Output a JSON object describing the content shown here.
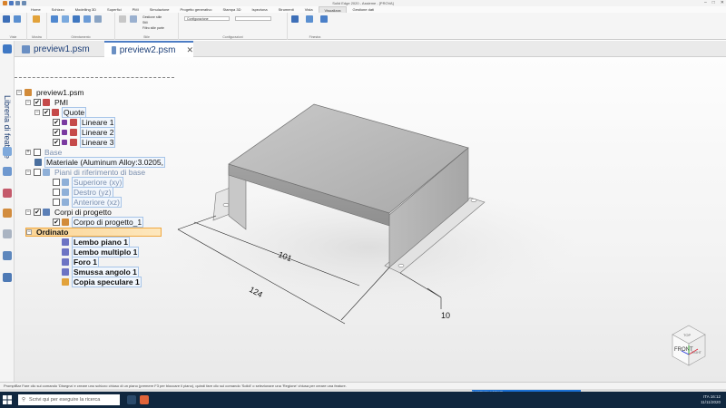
{
  "app": {
    "title": "Solid Edge 2020 - Assieme - [PROVA]"
  },
  "ribbon_tabs": [
    "Home",
    "Schizzo",
    "Modelling 3D",
    "Superfici",
    "PMI",
    "Simulazione",
    "Progetto generativo",
    "Stampa 3D",
    "Ispeziona",
    "Strumenti",
    "Vista",
    "Visualizza",
    "Gestione dati"
  ],
  "active_ribbon_tab": "Visualizza",
  "ribbon": {
    "groups": [
      {
        "label": "Viste",
        "items": [
          "Navigatore",
          "Viste"
        ]
      },
      {
        "label": "Mostra",
        "items": [
          "Mostra/Nascondi",
          "Mostra"
        ]
      },
      {
        "label": "Orientamento",
        "items": [
          "Vista rapida",
          "Zoom",
          "Ingrandisci",
          "Adatta"
        ]
      },
      {
        "label": "Stile",
        "items": [
          "Gestione stile",
          "Stili",
          "Filtro stile parte"
        ]
      },
      {
        "label": "Configurazioni",
        "items": [
          "Configurazione"
        ]
      },
      {
        "label": "Finestra",
        "items": [
          "Nuova finestra",
          "Disponi",
          "Cambia finestra"
        ]
      }
    ]
  },
  "sidebar": {
    "title": "Libreria di feature"
  },
  "doc_tabs": [
    {
      "label": "preview1.psm",
      "active": false
    },
    {
      "label": "preview2.psm",
      "active": true
    }
  ],
  "tree": {
    "root": "preview1.psm",
    "pmi": "PMI",
    "quote": "Quote",
    "dims": [
      "Lineare 1",
      "Lineare 2",
      "Lineare 3"
    ],
    "base": "Base",
    "materiale": "Materiale (Aluminum Alloy:3.0205,",
    "piani": "Piani di riferimento di base",
    "planes": [
      "Superiore (xy)",
      "Destro (yz)",
      "Anteriore (xz)"
    ],
    "corpi": "Corpi di progetto",
    "corpo1": "Corpo di progetto_1",
    "ordinato": "Ordinato",
    "features": [
      "Lembo piano 1",
      "Lembo multiplo 1",
      "Foro 1",
      "Smussa angolo 1",
      "Copia speculare 1"
    ]
  },
  "model": {
    "dims": [
      "101",
      "124",
      "10"
    ],
    "view_cube": {
      "front": "FRONT",
      "top": "TOP",
      "right": "RIGHT"
    }
  },
  "prompt_text": "PromptBar   Fare clic sul comando 'Disegna' e creare uno schizzo chiuso di un piano (premere F3 per bloccare il piano), quindi fare clic sul comando 'Solidi' o selezionare una 'Regione' chiusa per creare una feature.",
  "status": {
    "selection": "0 oggetti sono selezionati"
  },
  "taskbar": {
    "search_placeholder": "Scrivi qui per eseguire la ricerca",
    "time": "16:12",
    "date": "11/11/2020",
    "lang": "ITA"
  },
  "colors": {
    "accent": "#4c7cc4",
    "tree_text": "#1d3f78",
    "highlight": "#fbd596",
    "taskbar": "#10273f"
  }
}
